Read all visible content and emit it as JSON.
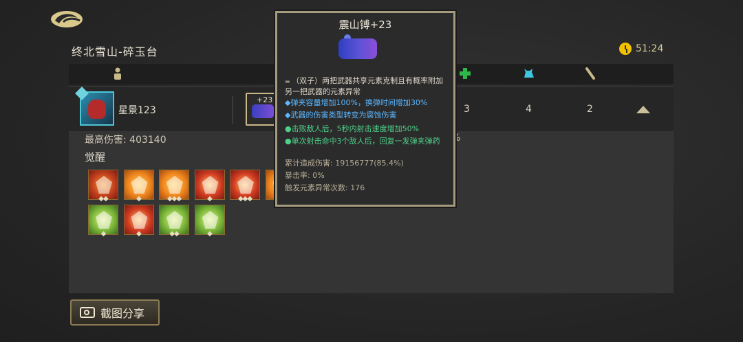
{
  "header": {
    "stage_title": "终北雪山-碎玉台",
    "timer": "51:24"
  },
  "player": {
    "name": "星景123",
    "weapon_level": "+23",
    "stats": [
      "3",
      "4",
      "2"
    ],
    "max_damage_label": "最高伤害: 403140",
    "pct_fragment": "%"
  },
  "awaken": {
    "label": "觉醒",
    "row1": [
      {
        "style": "red",
        "diamonds": "◆◆"
      },
      {
        "style": "org",
        "diamonds": "◆"
      },
      {
        "style": "org",
        "diamonds": "◆◆◆"
      },
      {
        "style": "red2",
        "diamonds": "◆"
      },
      {
        "style": "red2",
        "diamonds": "◆◆◆"
      },
      {
        "style": "org",
        "diamonds": ""
      }
    ],
    "row2": [
      {
        "style": "grn",
        "diamonds": "◆"
      },
      {
        "style": "red2",
        "diamonds": "◆"
      },
      {
        "style": "grn",
        "diamonds": "◆◆"
      },
      {
        "style": "grn",
        "diamonds": "◆"
      }
    ]
  },
  "tooltip": {
    "title": "震山镈+23",
    "lines": [
      {
        "text": "（双子）两把武器共享元素克制且有概率附加另一把武器的元素异常",
        "color": "white",
        "prefix": "▬"
      },
      {
        "text": "◆弹夹容量增加100%，换弹时间增加30%",
        "color": "blue",
        "prefix": ""
      },
      {
        "text": "◆武器的伤害类型转变为腐蚀伤害",
        "color": "blue",
        "prefix": ""
      },
      {
        "text": "●击败敌人后，5秒内射击速度增加50%",
        "color": "green",
        "prefix": ""
      },
      {
        "text": "●单次射击命中3个敌人后，回复一发弹夹弹药",
        "color": "green",
        "prefix": ""
      },
      {
        "text": "累计造成伤害: 19156777(85.4%)",
        "color": "gray",
        "prefix": ""
      },
      {
        "text": "暴击率: 0%",
        "color": "gray",
        "prefix": ""
      },
      {
        "text": "触发元素异常次数: 176",
        "color": "gray",
        "prefix": ""
      }
    ]
  },
  "share_button": "截图分享",
  "colors": {
    "accent_gold": "#c9b989",
    "timer_yellow": "#f2c200",
    "highlight_cyan": "#4ec7d6",
    "text_blue": "#5bb7ff",
    "text_green": "#4fd08a"
  }
}
